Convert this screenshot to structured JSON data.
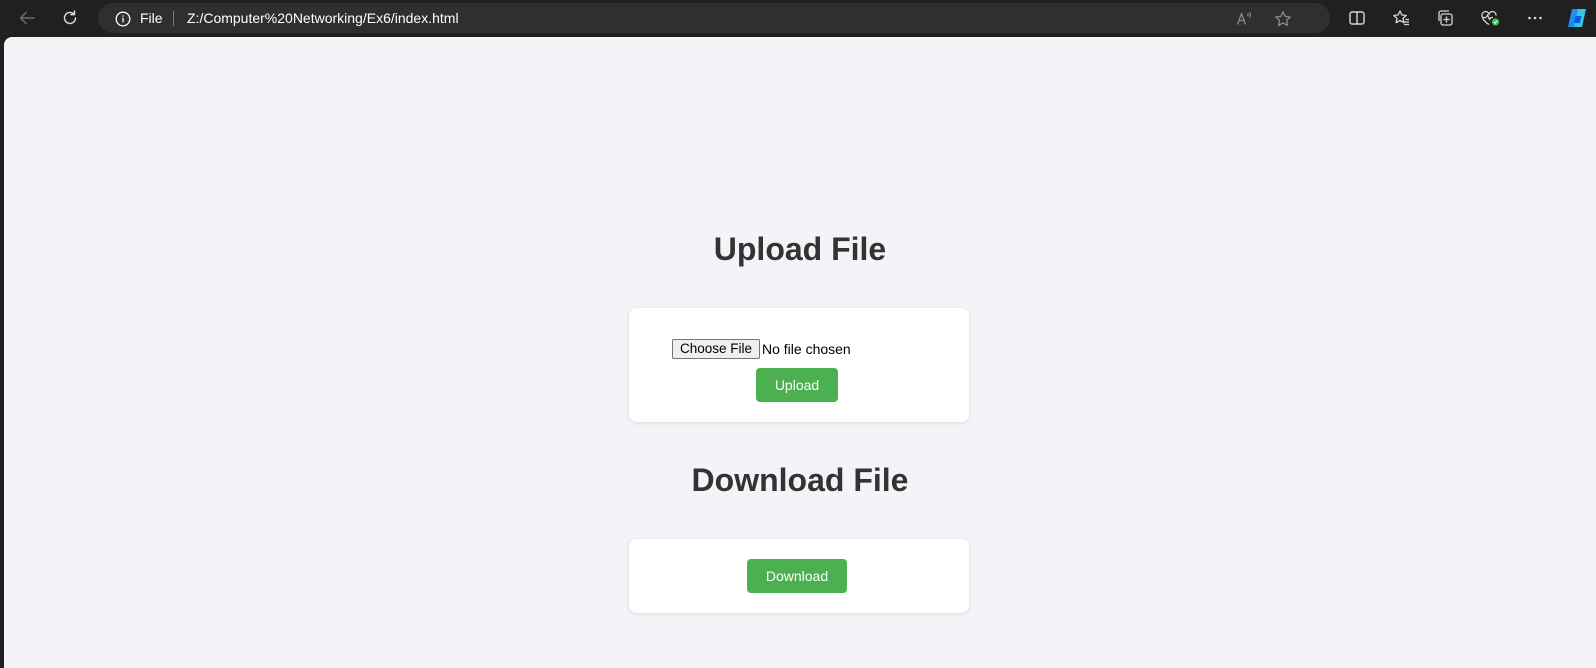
{
  "browser": {
    "address": {
      "scheme_label": "File",
      "url": "Z:/Computer%20Networking/Ex6/index.html"
    },
    "icons": {
      "back": "back-arrow-icon",
      "refresh": "refresh-icon",
      "info": "info-icon",
      "read_aloud": "read-aloud-icon",
      "favorite": "star-icon",
      "split_screen": "split-screen-icon",
      "favorites": "favorites-icon",
      "collections": "collections-icon",
      "browser_essentials": "heart-pulse-icon",
      "more": "more-icon",
      "copilot": "copilot-icon"
    }
  },
  "page": {
    "upload_section": {
      "heading": "Upload File",
      "choose_file_label": "Choose File",
      "file_status": "No file chosen",
      "upload_button": "Upload"
    },
    "download_section": {
      "heading": "Download File",
      "download_button": "Download"
    }
  },
  "colors": {
    "chrome_bg": "#202020",
    "address_bg": "#2f2f2f",
    "page_bg": "#f4f4f8",
    "heading_text": "#333333",
    "button_green": "#4caf50",
    "card_bg": "#ffffff"
  }
}
